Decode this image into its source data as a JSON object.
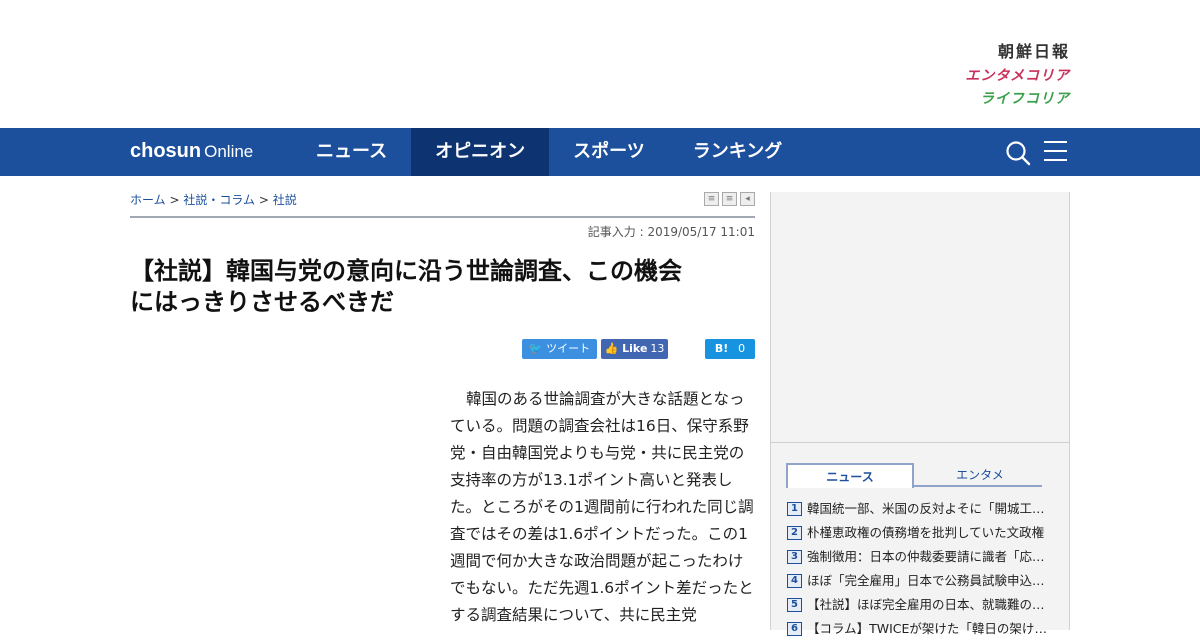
{
  "brand": {
    "chosun_ilbo": "朝鮮日報",
    "entame_korea": "エンタメコリア",
    "life_korea": "ライフコリア"
  },
  "nav": {
    "logo_bold": "chosun",
    "logo_light": "Online",
    "items": [
      {
        "label": "ニュース"
      },
      {
        "label": "オピニオン",
        "active": true
      },
      {
        "label": "スポーツ"
      },
      {
        "label": "ランキング"
      }
    ],
    "icons": [
      "search-icon",
      "menu-icon"
    ]
  },
  "breadcrumb": {
    "home": "ホーム",
    "sep": ">",
    "section": "社説・コラム",
    "current": "社説"
  },
  "article": {
    "dateline": "記事入力 : 2019/05/17 11:01",
    "headline_line1": "【社説】韓国与党の意向に沿う世論調査、この機会",
    "headline_line2": "にはっきりさせるべきだ",
    "body": "韓国のある世論調査が大きな話題となっている。問題の調査会社は16日、保守系野党・自由韓国党よりも与党・共に民主党の支持率の方が13.1ポイント高いと発表した。ところがその1週間前に行われた同じ調査ではその差は1.6ポイントだった。この1週間で何か大きな政治問題が起こったわけでもない。ただ先週1.6ポイント差だったとする調査結果について、共に民主党"
  },
  "share": {
    "tweet": "ツイート",
    "like": "Like",
    "like_count": "13",
    "hatena": "B!",
    "hatena_count": "0"
  },
  "sidebar": {
    "tabs": [
      {
        "label": "ニュース",
        "active": true
      },
      {
        "label": "エンタメ"
      }
    ],
    "ranking": [
      {
        "num": "1",
        "title": "韓国統一部、米国の反対よそに「開城工業団地"
      },
      {
        "num": "2",
        "title": "朴槿恵政権の債務増を批判していた文政権"
      },
      {
        "num": "3",
        "title": "強制徴用：日本の仲裁委要請に識者「応じる"
      },
      {
        "num": "4",
        "title": "ほぼ「完全雇用」日本で公務員試験申込者減"
      },
      {
        "num": "5",
        "title": "【社説】ほぼ完全雇用の日本、就職難の韓国"
      },
      {
        "num": "6",
        "title": "【コラム】TWICEが架けた「韓日の架け橋」"
      }
    ]
  },
  "colors": {
    "nav_bg": "#1c4f9c",
    "nav_active": "#0d3470",
    "link": "#1c4f9c"
  }
}
